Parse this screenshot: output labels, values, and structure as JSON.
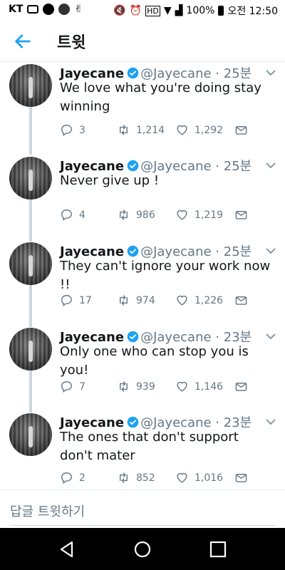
{
  "status_bar": {
    "carrier": "KT",
    "battery_percent": "100%",
    "time": "오전 12:50"
  },
  "app_bar": {
    "title": "트윗"
  },
  "tweets": [
    {
      "name": "Jayecane",
      "handle": "@Jayecane",
      "time": "· 25분",
      "text": "We love what you're doing stay winning",
      "replies": "3",
      "retweets": "1,214",
      "likes": "1,292"
    },
    {
      "name": "Jayecane",
      "handle": "@Jayecane",
      "time": "· 25분",
      "text": "Never give up !",
      "replies": "4",
      "retweets": "986",
      "likes": "1,219"
    },
    {
      "name": "Jayecane",
      "handle": "@Jayecane",
      "time": "· 25분",
      "text": "They can't ignore your work now !!",
      "replies": "17",
      "retweets": "974",
      "likes": "1,226"
    },
    {
      "name": "Jayecane",
      "handle": "@Jayecane",
      "time": "· 23분",
      "text": "Only one who can stop you is you!",
      "replies": "7",
      "retweets": "939",
      "likes": "1,146"
    },
    {
      "name": "Jayecane",
      "handle": "@Jayecane",
      "time": "· 23분",
      "text": "The ones that don't support don't mater",
      "replies": "2",
      "retweets": "852",
      "likes": "1,016"
    }
  ],
  "composer": {
    "placeholder": "답글 트윗하기"
  },
  "colors": {
    "accent": "#1da1f2",
    "text": "#14171a",
    "secondary": "#657786",
    "thread_line": "#ccd6dd"
  },
  "icons": {
    "back": "arrow-left-icon",
    "verified": "verified-badge-icon",
    "reply": "reply-icon",
    "retweet": "retweet-icon",
    "like": "heart-icon",
    "share": "share-icon",
    "caret": "chevron-down-icon"
  }
}
